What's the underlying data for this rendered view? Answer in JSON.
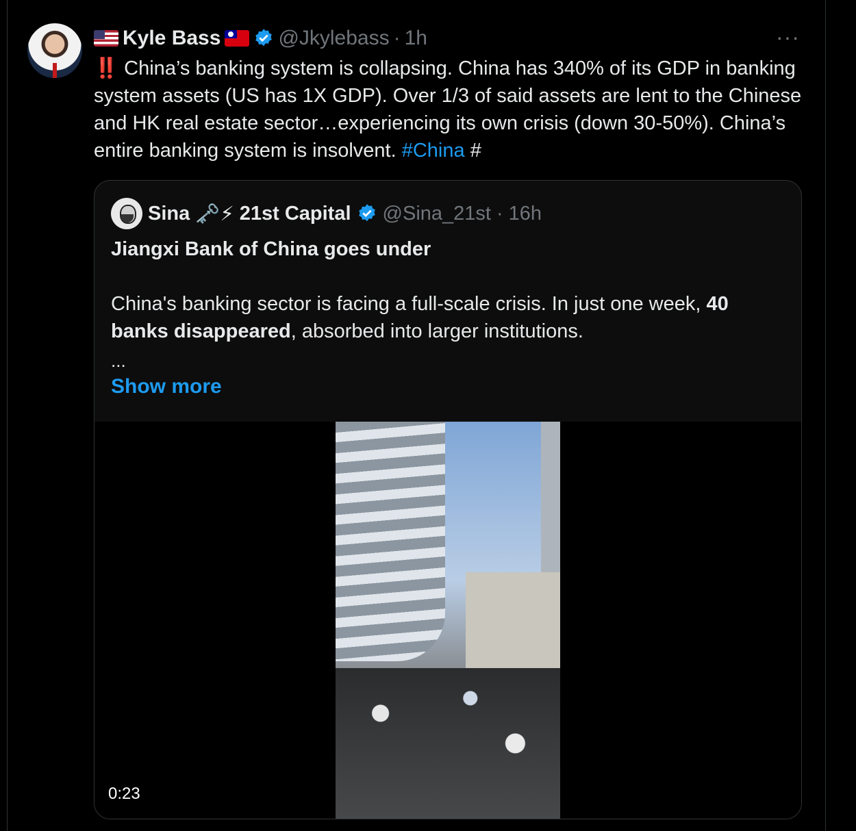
{
  "tweet": {
    "author_name": "Kyle Bass",
    "handle": "@Jkylebass",
    "separator": "·",
    "time": "1h",
    "more_label": "···",
    "emoji_prefix": "‼️",
    "text": "China’s banking system is collapsing. China has 340% of its GDP in banking system assets (US has 1X GDP). Over 1/3 of said assets are lent to the Chinese and HK real estate sector…experiencing its own crisis (down 30-50%). China’s entire banking system is insolvent.",
    "hashtag": "#China",
    "trailing": "#"
  },
  "quote": {
    "author_name": "Sina",
    "author_emojis": "🗝️⚡",
    "author_suffix": "21st Capital",
    "handle": "@Sina_21st",
    "separator": "·",
    "time": "16h",
    "title": "Jiangxi Bank of China goes under",
    "body_pre": "China's banking sector is facing a full-scale crisis. In just one week,",
    "body_bold": "40 banks disappeared",
    "body_post": ", absorbed into larger institutions.",
    "ellipsis": "...",
    "show_more": "Show more",
    "video_duration": "0:23"
  },
  "colors": {
    "accent": "#1d9bf0",
    "background": "#000000",
    "muted": "#71767b"
  }
}
